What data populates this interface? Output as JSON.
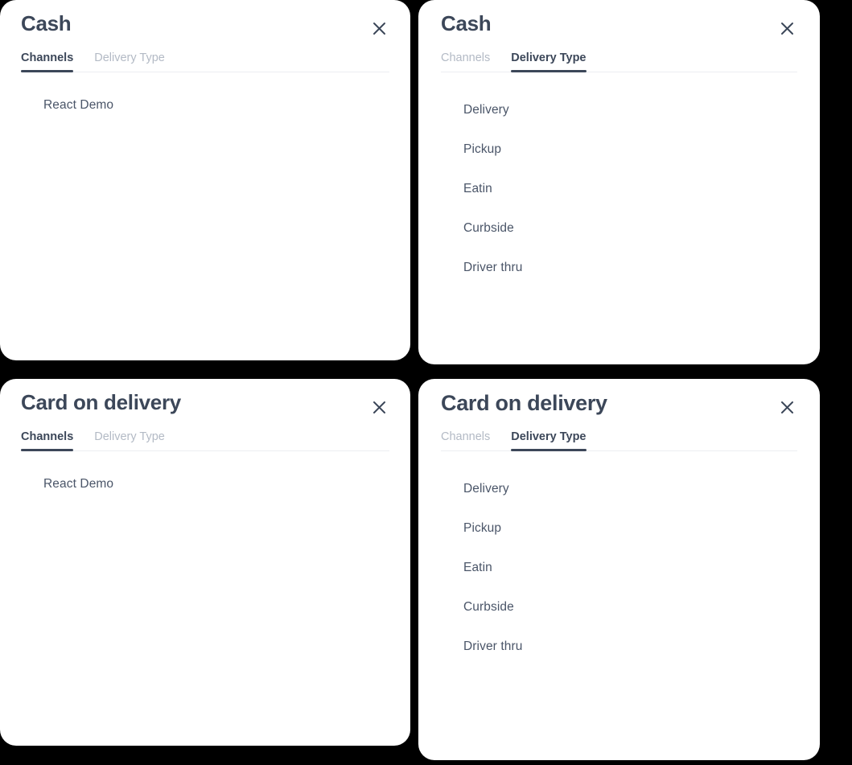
{
  "theme": {
    "background": "#000000",
    "card_background": "#ffffff",
    "title_color": "#3c4759",
    "tab_active_color": "#3c4759",
    "tab_inactive_color": "#b3bac5",
    "label_color": "#4a5568",
    "divider_color": "#eceef1"
  },
  "icons": {
    "close": "close-icon",
    "checkbox_unchecked": "checkbox-unchecked-icon"
  },
  "tabs": {
    "channels": "Channels",
    "delivery_type": "Delivery Type"
  },
  "panels": [
    {
      "id": "cash-channels",
      "title": "Cash",
      "active_tab": "Channels",
      "tabs": [
        "Channels",
        "Delivery Type"
      ],
      "options": [
        "React Demo"
      ]
    },
    {
      "id": "cash-delivery-type",
      "title": "Cash",
      "active_tab": "Delivery Type",
      "tabs": [
        "Channels",
        "Delivery Type"
      ],
      "options": [
        "Delivery",
        "Pickup",
        "Eatin",
        "Curbside",
        "Driver thru"
      ]
    },
    {
      "id": "card-on-delivery-channels",
      "title": "Card on delivery",
      "active_tab": "Channels",
      "tabs": [
        "Channels",
        "Delivery Type"
      ],
      "options": [
        "React Demo"
      ]
    },
    {
      "id": "card-on-delivery-delivery-type",
      "title": "Card on delivery",
      "active_tab": "Delivery Type",
      "tabs": [
        "Channels",
        "Delivery Type"
      ],
      "options": [
        "Delivery",
        "Pickup",
        "Eatin",
        "Curbside",
        "Driver thru"
      ]
    }
  ]
}
